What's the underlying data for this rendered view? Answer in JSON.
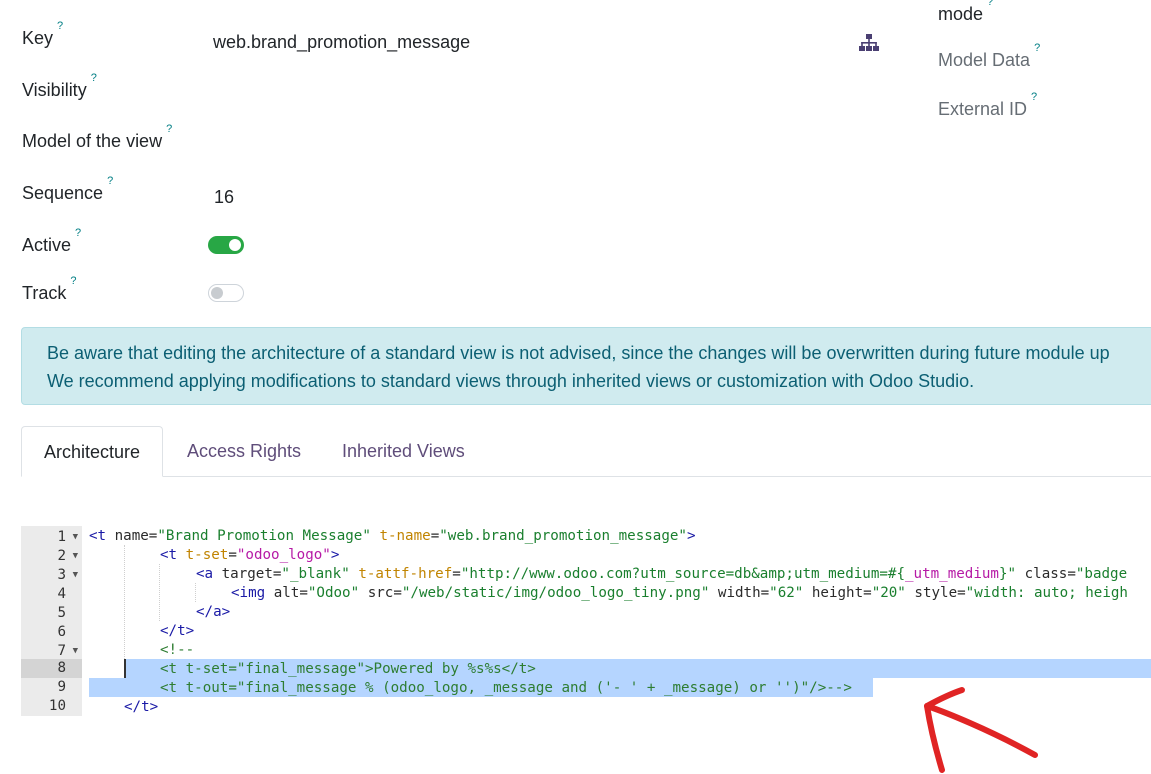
{
  "fields": {
    "key": {
      "label": "Key",
      "help": "?",
      "value": "web.brand_promotion_message"
    },
    "visibility": {
      "label": "Visibility",
      "help": "?"
    },
    "model": {
      "label": "Model of the view",
      "help": "?"
    },
    "sequence": {
      "label": "Sequence",
      "help": "?",
      "value": "16"
    },
    "active": {
      "label": "Active",
      "help": "?",
      "state": true
    },
    "track": {
      "label": "Track",
      "help": "?",
      "state": false
    }
  },
  "right_fields": {
    "mode": {
      "label": "mode",
      "help": "?"
    },
    "model_data": {
      "label": "Model Data",
      "help": "?"
    },
    "external_id": {
      "label": "External ID",
      "help": "?"
    }
  },
  "icons": {
    "hierarchy": "sitemap-icon"
  },
  "alert": {
    "line1": "Be aware that editing the architecture of a standard view is not advised, since the changes will be overwritten during future module up",
    "line2": "We recommend applying modifications to standard views through inherited views or customization with Odoo Studio."
  },
  "tabs": [
    {
      "label": "Architecture",
      "active": true
    },
    {
      "label": "Access Rights",
      "active": false
    },
    {
      "label": "Inherited Views",
      "active": false
    }
  ],
  "code": {
    "line_numbers": [
      "1",
      "2",
      "3",
      "4",
      "5",
      "6",
      "7",
      "8",
      "9",
      "10"
    ],
    "l1": {
      "open": "<t ",
      "a1": "name",
      "eq1": "=",
      "v1": "\"Brand Promotion Message\"",
      "a2": "t-name",
      "eq2": "=",
      "v2": "\"web.brand_promotion_message\"",
      "close": ">"
    },
    "l2": {
      "open": "<t ",
      "a1": "t-set",
      "eq1": "=",
      "v1": "\"odoo_logo\"",
      "close": ">"
    },
    "l3": {
      "open": "<a ",
      "a1": "target",
      "eq1": "=",
      "v1": "\"_blank\"",
      "a2": "t-attf-href",
      "eq2": "=",
      "v2a": "\"http://www.odoo.com?utm_source=db&amp;utm_medium=#{",
      "v2b": "_utm_medium",
      "v2c": "}\"",
      "a3": "class",
      "eq3": "=",
      "v3": "\"badge"
    },
    "l4": {
      "open": "<img ",
      "a1": "alt",
      "eq1": "=",
      "v1": "\"Odoo\"",
      "a2": "src",
      "eq2": "=",
      "v2": "\"/web/static/img/odoo_logo_tiny.png\"",
      "a3": "width",
      "eq3": "=",
      "v3": "\"62\"",
      "a4": "height",
      "eq4": "=",
      "v4": "\"20\"",
      "a5": "style",
      "eq5": "=",
      "v5": "\"width: auto; heigh"
    },
    "l5": "</a>",
    "l6": "</t>",
    "l7": "<!--",
    "l8": "<t t-set=\"final_message\">Powered by %s%s</t>",
    "l9": "<t t-out=\"final_message % (odoo_logo, _message and ('- ' + _message) or '')\"/>-->",
    "l10": "</t>"
  },
  "annotation": {
    "color": "#e02424"
  }
}
